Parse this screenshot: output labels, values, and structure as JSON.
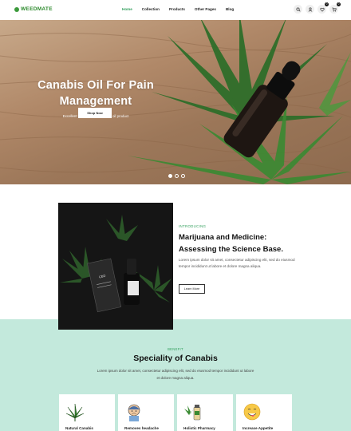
{
  "header": {
    "logo": "WEEDMATE",
    "nav": [
      "Home",
      "Collection",
      "Products",
      "Other Pages",
      "Blog"
    ],
    "active_index": 0,
    "icons": [
      "search-icon",
      "user-icon",
      "heart-icon",
      "cart-icon"
    ],
    "wishlist_count": "0",
    "cart_count": "0"
  },
  "hero": {
    "title": "Canabis Oil For Pain Management",
    "subtitle": "Excellent our exclusive canabis oil product",
    "button": "Shop Now",
    "slides": 3,
    "active_slide": 0
  },
  "intro": {
    "kicker": "INTRODUCING",
    "title": "Marijuana and Medicine: Assessing the Science Base.",
    "text": "Lorem ipsum dolor sit amet, consectetur adipiscing elit, sed do eiusmod tempor incididunt ut labore et dolore magna aliqua.",
    "button": "Learn More"
  },
  "benefit": {
    "kicker": "BENEFIT",
    "title": "Speciality of Canabis",
    "text": "Lorem ipsum dolor sit amet, consectetur adipiscing elit, sed do eiusmod tempor incididunt ut labore et dolore magna aliqua.",
    "cards": [
      {
        "label": "Natural Canabis",
        "icon": "cannabis-leaf-icon"
      },
      {
        "label": "Removes headache",
        "icon": "headache-icon"
      },
      {
        "label": "Holistic Pharmacy",
        "icon": "pharmacy-icon"
      },
      {
        "label": "Increase Appetite",
        "icon": "appetite-icon"
      }
    ]
  },
  "colors": {
    "accent": "#2f9e5a",
    "benefit_bg": "#c3e9dc",
    "logo": "#2c8a2c"
  }
}
